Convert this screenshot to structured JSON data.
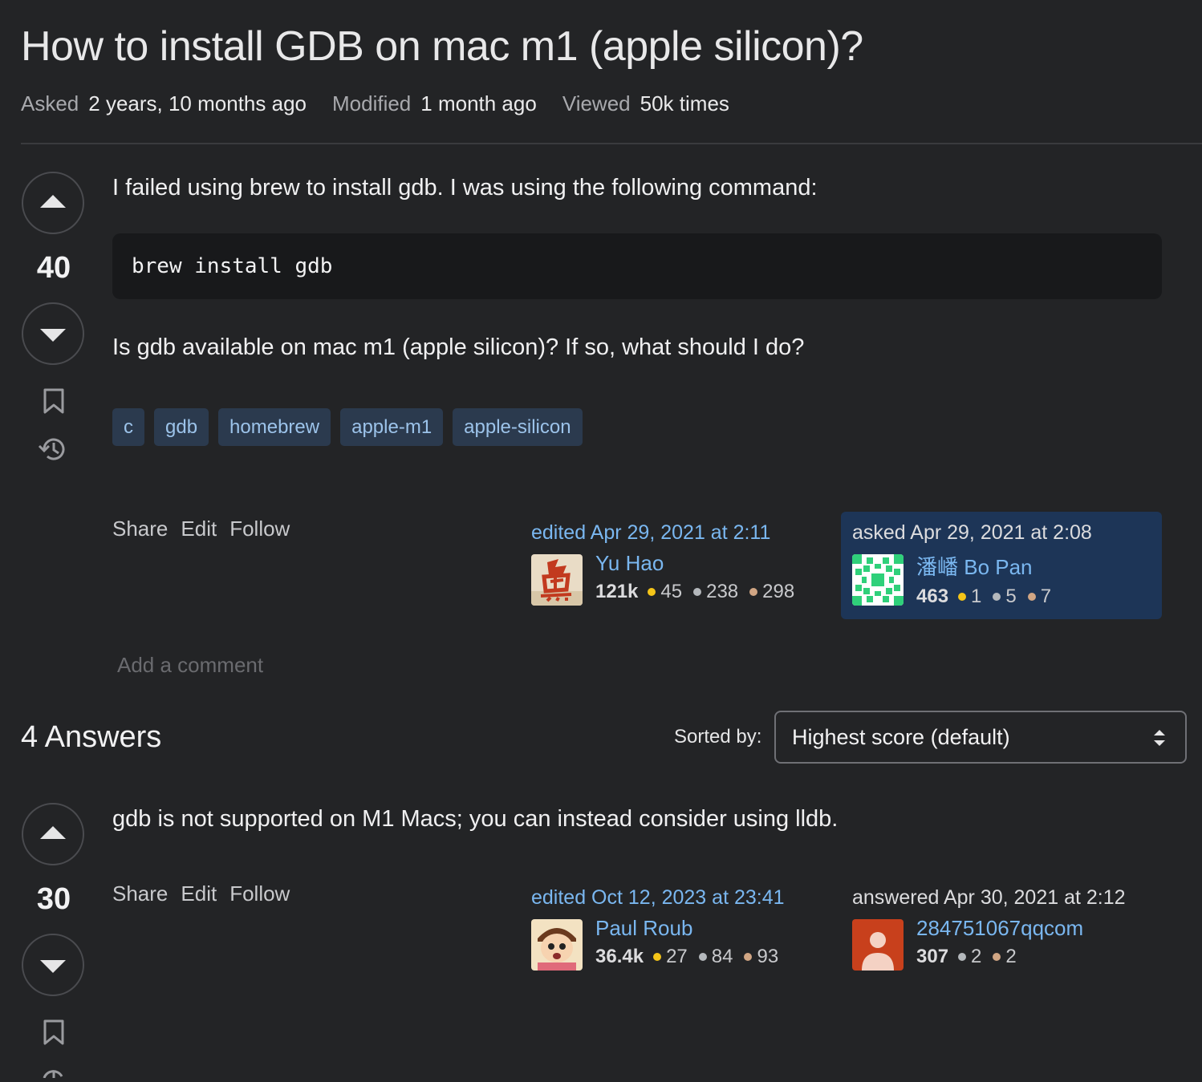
{
  "question": {
    "title": "How to install GDB on mac m1 (apple silicon)?",
    "meta": {
      "asked_label": "Asked",
      "asked_value": "2 years, 10 months ago",
      "modified_label": "Modified",
      "modified_value": "1 month ago",
      "viewed_label": "Viewed",
      "viewed_value": "50k times"
    },
    "score": "40",
    "body_line1": "I failed using brew to install gdb. I was using the following command:",
    "code": "brew install gdb",
    "body_line2": "Is gdb available on mac m1 (apple silicon)? If so, what should I do?",
    "tags": [
      "c",
      "gdb",
      "homebrew",
      "apple-m1",
      "apple-silicon"
    ],
    "actions": {
      "share": "Share",
      "edit": "Edit",
      "follow": "Follow"
    },
    "editor": {
      "time": "edited Apr 29, 2021 at 2:11",
      "name": "Yu Hao",
      "rep": "121k",
      "gold": "45",
      "silver": "238",
      "bronze": "298"
    },
    "asker": {
      "time": "asked Apr 29, 2021 at 2:08",
      "name": "潘嶓 Bo Pan",
      "rep": "463",
      "gold": "1",
      "silver": "5",
      "bronze": "7"
    },
    "add_comment": "Add a comment"
  },
  "answers_header": {
    "count_label": "4 Answers",
    "sorted_label": "Sorted by:",
    "sort_value": "Highest score (default)"
  },
  "answer1": {
    "score": "30",
    "body": "gdb is not supported on M1 Macs; you can instead consider using lldb.",
    "actions": {
      "share": "Share",
      "edit": "Edit",
      "follow": "Follow"
    },
    "editor": {
      "time": "edited Oct 12, 2023 at 23:41",
      "name": "Paul Roub",
      "rep": "36.4k",
      "gold": "27",
      "silver": "84",
      "bronze": "93"
    },
    "answerer": {
      "time": "answered Apr 30, 2021 at 2:12",
      "name": "284751067qqcom",
      "rep": "307",
      "silver": "2",
      "bronze": "2"
    }
  },
  "colors": {
    "background": "#232426",
    "link": "#7ab7f0",
    "tag_bg": "#2b3a4e",
    "tag_text": "#9cc3ea",
    "asker_card_bg": "#1d3557"
  }
}
